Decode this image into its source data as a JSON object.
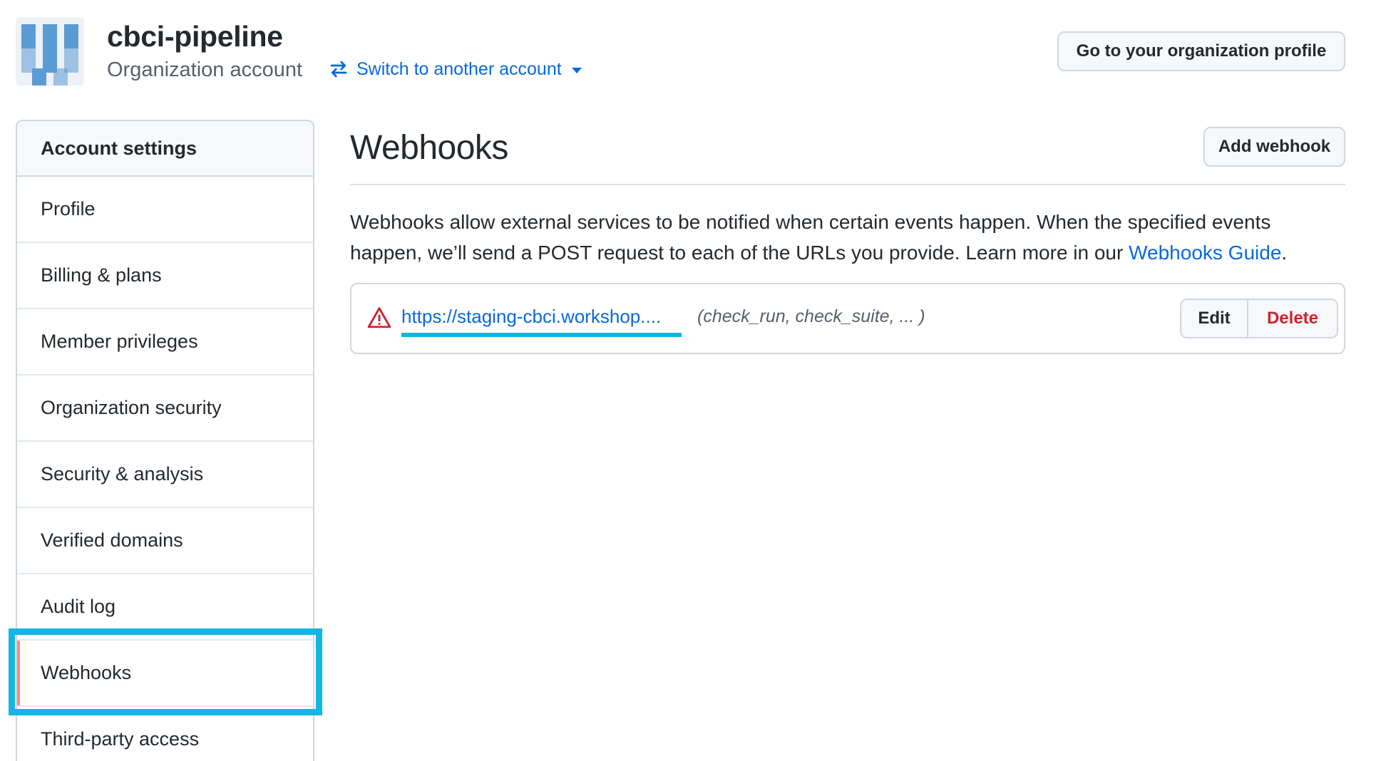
{
  "header": {
    "org_name": "cbci-pipeline",
    "org_type": "Organization account",
    "switch_label": "Switch to another account",
    "org_profile_button": "Go to your organization profile"
  },
  "sidebar": {
    "heading": "Account settings",
    "items": [
      {
        "label": "Profile"
      },
      {
        "label": "Billing & plans"
      },
      {
        "label": "Member privileges"
      },
      {
        "label": "Organization security"
      },
      {
        "label": "Security & analysis"
      },
      {
        "label": "Verified domains"
      },
      {
        "label": "Audit log"
      },
      {
        "label": "Webhooks",
        "selected": true
      },
      {
        "label": "Third-party access"
      }
    ]
  },
  "main": {
    "title": "Webhooks",
    "add_button": "Add webhook",
    "description": "Webhooks allow external services to be notified when certain events happen. When the specified events happen, we’ll send a POST request to each of the URLs you provide. Learn more in our ",
    "guide_link": "Webhooks Guide",
    "description_end": ".",
    "webhooks": [
      {
        "url": "https://staging-cbci.workshop....",
        "events": "(check_run, check_suite, ... )",
        "status_icon": "alert-triangle-icon",
        "edit_label": "Edit",
        "delete_label": "Delete"
      }
    ]
  },
  "colors": {
    "link": "#0969da",
    "danger": "#cf222e",
    "highlight": "#12b5e3",
    "selected_bar": "#fd8c73"
  }
}
